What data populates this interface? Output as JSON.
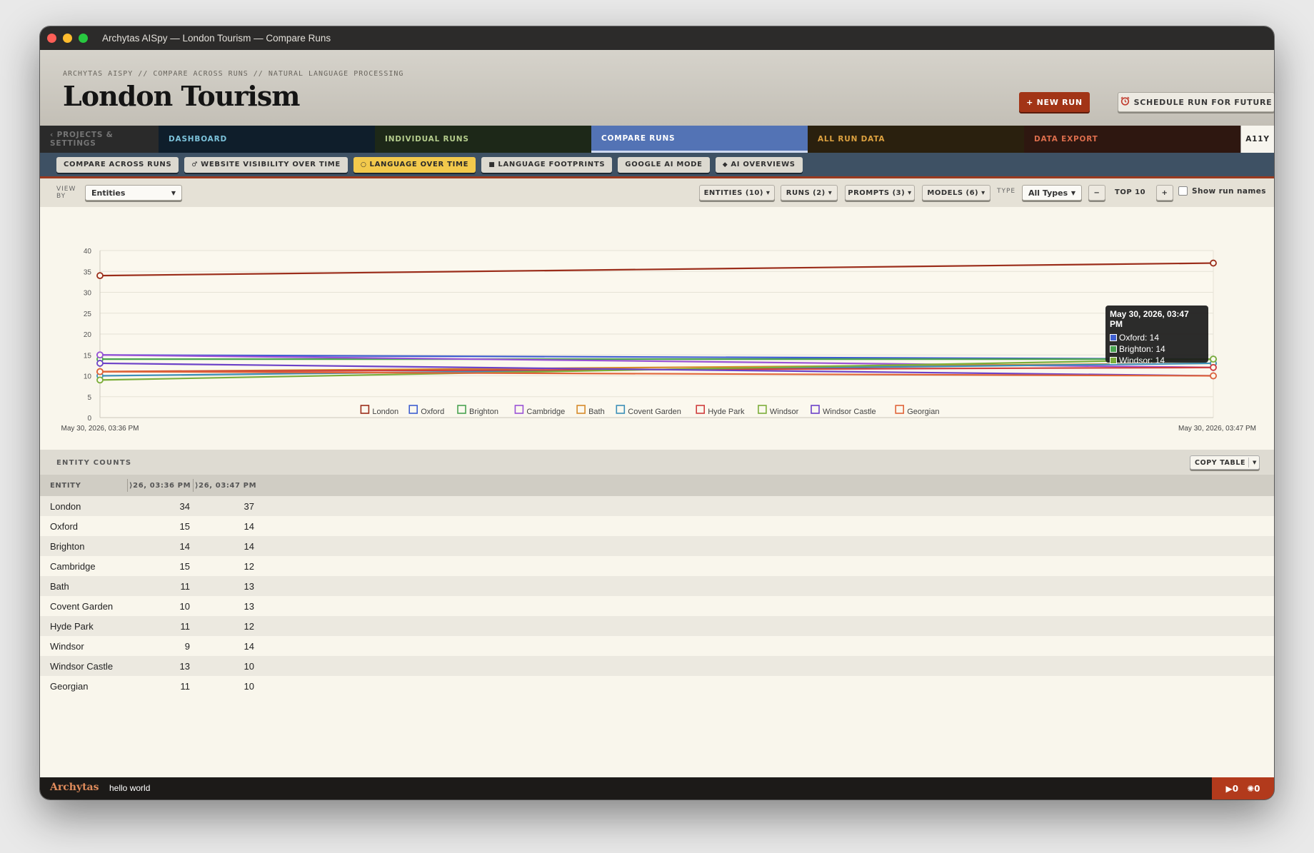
{
  "window": {
    "title": "Archytas AISpy — London Tourism — Compare Runs"
  },
  "header": {
    "breadcrumb": "ARCHYTAS AISPY // COMPARE ACROSS RUNS // NATURAL LANGUAGE PROCESSING",
    "title": "London Tourism",
    "new_run_label": "+ NEW RUN",
    "schedule_label": "SCHEDULE RUN FOR FUTURE"
  },
  "nav": {
    "projects": "‹ PROJECTS & SETTINGS",
    "dashboard": "DASHBOARD",
    "individual": "INDIVIDUAL RUNS",
    "compare": "COMPARE RUNS",
    "allrun": "ALL RUN DATA",
    "export": "DATA EXPORT",
    "a11y": "A11Y"
  },
  "subnav": [
    {
      "label": "COMPARE ACROSS RUNS",
      "icon": ""
    },
    {
      "label": "WEBSITE VISIBILITY OVER TIME",
      "icon": "♂"
    },
    {
      "label": "LANGUAGE OVER TIME",
      "icon": "○"
    },
    {
      "label": "LANGUAGE FOOTPRINTS",
      "icon": "■"
    },
    {
      "label": "GOOGLE AI MODE",
      "icon": ""
    },
    {
      "label": "AI OVERVIEWS",
      "icon": "◆"
    }
  ],
  "toolbar": {
    "viewby_label": "VIEW BY",
    "viewby_value": "Entities",
    "entities": "ENTITIES (10) ▾",
    "runs": "RUNS (2) ▾",
    "prompts": "PROMPTS (3) ▾",
    "models": "MODELS (6) ▾",
    "type_label": "TYPE",
    "type_value": "All Types",
    "minus": "−",
    "top_label": "TOP 10",
    "plus": "+",
    "show_run_names": "Show run names"
  },
  "chart_data": {
    "type": "line",
    "x": [
      "May 30, 2026, 03:36 PM",
      "May 30, 2026, 03:47 PM"
    ],
    "ylim": [
      0,
      40
    ],
    "yticks": [
      0,
      5,
      10,
      15,
      20,
      25,
      30,
      35,
      40
    ],
    "grid": true,
    "legend_position": "bottom",
    "series": [
      {
        "name": "London",
        "color": "#9b2d1a",
        "values": [
          34,
          37
        ]
      },
      {
        "name": "Oxford",
        "color": "#3f5fd0",
        "values": [
          15,
          14
        ]
      },
      {
        "name": "Brighton",
        "color": "#4aa351",
        "values": [
          14,
          14
        ]
      },
      {
        "name": "Cambridge",
        "color": "#9a52d6",
        "values": [
          15,
          12
        ]
      },
      {
        "name": "Bath",
        "color": "#d68a2a",
        "values": [
          11,
          13
        ]
      },
      {
        "name": "Covent Garden",
        "color": "#3c8fb8",
        "values": [
          10,
          13
        ]
      },
      {
        "name": "Hyde Park",
        "color": "#cf3e3e",
        "values": [
          11,
          12
        ]
      },
      {
        "name": "Windsor",
        "color": "#7cae3a",
        "values": [
          9,
          14
        ]
      },
      {
        "name": "Windsor Castle",
        "color": "#6c42c8",
        "values": [
          13,
          10
        ]
      },
      {
        "name": "Georgian",
        "color": "#e0653a",
        "values": [
          11,
          10
        ]
      }
    ]
  },
  "tooltip": {
    "title": "May 30, 2026, 03:47 PM",
    "rows": [
      {
        "text": "Oxford: 14",
        "color": "#3f5fd0"
      },
      {
        "text": "Brighton: 14",
        "color": "#4aa351"
      },
      {
        "text": "Windsor: 14",
        "color": "#7cae3a"
      }
    ]
  },
  "counts": {
    "title": "ENTITY COUNTS",
    "copy_label": "COPY TABLE",
    "headers": [
      "ENTITY",
      "⟩26, 03:36 PM",
      "⟩26, 03:47 PM"
    ],
    "rows": [
      {
        "entity": "London",
        "v1": "34",
        "v2": "37"
      },
      {
        "entity": "Oxford",
        "v1": "15",
        "v2": "14"
      },
      {
        "entity": "Brighton",
        "v1": "14",
        "v2": "14"
      },
      {
        "entity": "Cambridge",
        "v1": "15",
        "v2": "12"
      },
      {
        "entity": "Bath",
        "v1": "11",
        "v2": "13"
      },
      {
        "entity": "Covent Garden",
        "v1": "10",
        "v2": "13"
      },
      {
        "entity": "Hyde Park",
        "v1": "11",
        "v2": "12"
      },
      {
        "entity": "Windsor",
        "v1": "9",
        "v2": "14"
      },
      {
        "entity": "Windsor Castle",
        "v1": "13",
        "v2": "10"
      },
      {
        "entity": "Georgian",
        "v1": "11",
        "v2": "10"
      }
    ]
  },
  "status": {
    "brand": "Archytas",
    "message": "hello world",
    "runs_count": "▶0",
    "bugs_count": "✺0"
  }
}
